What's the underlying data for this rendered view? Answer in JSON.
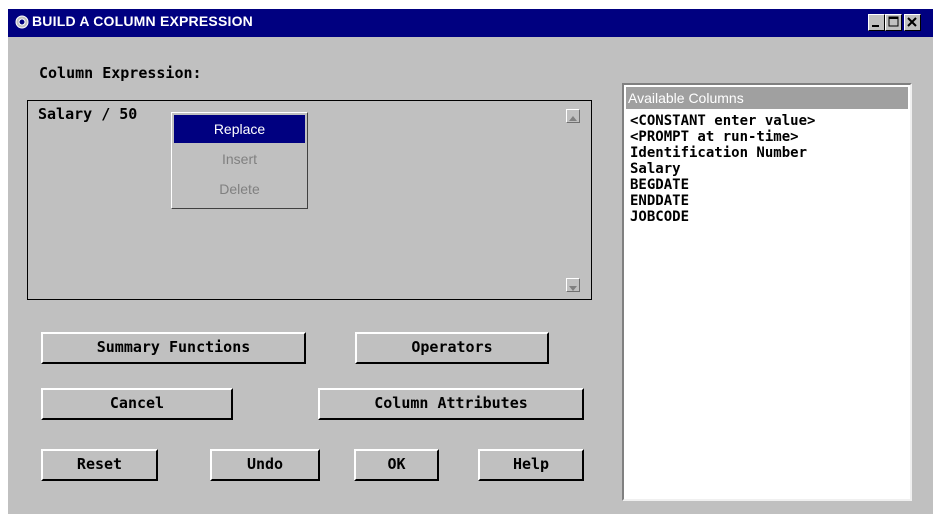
{
  "window": {
    "title": "BUILD A COLUMN EXPRESSION",
    "minimize": "_",
    "maximize": "□",
    "close": "×"
  },
  "expression": {
    "label": "Column Expression:",
    "value": "Salary / 50"
  },
  "context_menu": {
    "items": [
      "Replace",
      "Insert",
      "Delete"
    ],
    "selected": "Replace"
  },
  "buttons": {
    "summary_functions": "Summary Functions",
    "operators": "Operators",
    "cancel": "Cancel",
    "column_attributes": "Column Attributes",
    "reset": "Reset",
    "undo": "Undo",
    "ok": "OK",
    "help": "Help"
  },
  "available_columns": {
    "header": "Available Columns",
    "items": [
      "<CONSTANT enter value>",
      "<PROMPT at run-time>",
      "Identification Number",
      "Salary",
      "BEGDATE",
      "ENDDATE",
      "JOBCODE"
    ]
  },
  "colors": {
    "titlebar": "#000080",
    "face": "#c0c0c0",
    "selection": "#000080",
    "list_header": "#a0a0a0"
  }
}
